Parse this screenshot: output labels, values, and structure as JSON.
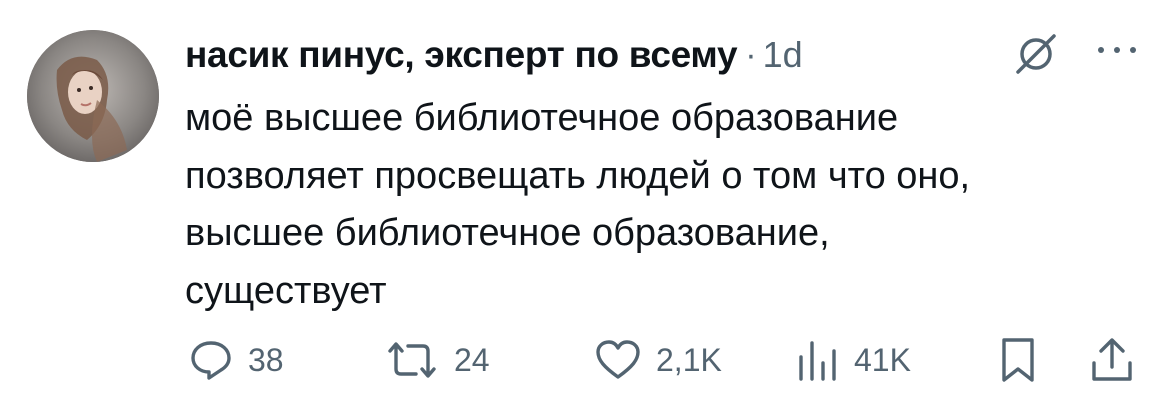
{
  "tweet": {
    "author": "насик пинус, эксперт по всему",
    "separator": "·",
    "time": "1d",
    "lines": [
      "моё высшее библиотечное образование",
      "позволяет просвещать людей о том что оно,",
      "высшее библиотечное образование,",
      "существует"
    ]
  },
  "actions": {
    "replies": "38",
    "retweets": "24",
    "likes": "2,1K",
    "views": "41K"
  },
  "colors": {
    "text": "#0f1419",
    "secondary": "#536471"
  }
}
